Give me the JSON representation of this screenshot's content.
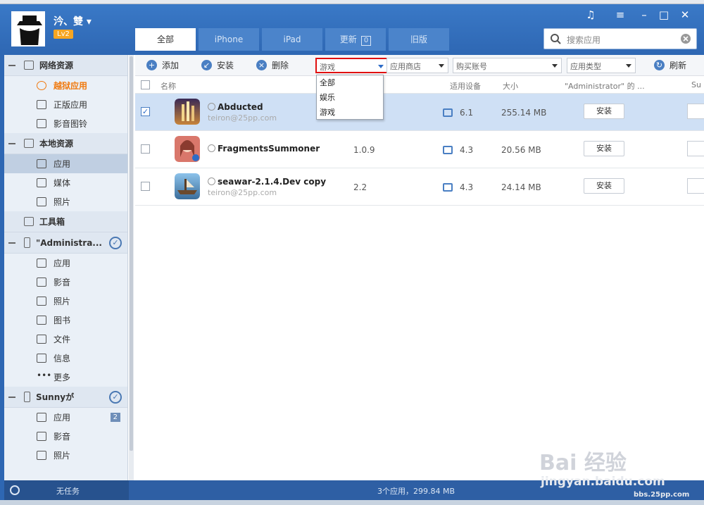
{
  "user": {
    "name": "汵、雙 ▾",
    "level": "Lv2"
  },
  "tabs": [
    {
      "label": "全部",
      "active": true
    },
    {
      "label": "iPhone"
    },
    {
      "label": "iPad"
    },
    {
      "label": "更新",
      "count": "0"
    },
    {
      "label": "旧版"
    }
  ],
  "search": {
    "placeholder": "搜索应用"
  },
  "sidebar": {
    "groups": [
      {
        "label": "网络资源",
        "items": [
          {
            "label": "越狱应用",
            "highlight": true
          },
          {
            "label": "正版应用"
          },
          {
            "label": "影音图铃"
          }
        ]
      },
      {
        "label": "本地资源",
        "items": [
          {
            "label": "应用",
            "selected": true
          },
          {
            "label": "媒体"
          },
          {
            "label": "照片"
          }
        ]
      },
      {
        "label": "工具箱",
        "items": []
      },
      {
        "label": "\"Administra...",
        "items": [
          {
            "label": "应用"
          },
          {
            "label": "影音"
          },
          {
            "label": "照片"
          },
          {
            "label": "图书"
          },
          {
            "label": "文件"
          },
          {
            "label": "信息"
          },
          {
            "label": "更多"
          }
        ]
      },
      {
        "label": "Sunnyが",
        "items": [
          {
            "label": "应用",
            "badge": "2"
          },
          {
            "label": "影音"
          },
          {
            "label": "照片"
          }
        ]
      }
    ]
  },
  "toolbar": {
    "add": "添加",
    "install": "安装",
    "delete": "删除",
    "refresh": "刷新",
    "category_value": "游戏",
    "store_value": "应用商店",
    "account_value": "购买账号",
    "type_value": "应用类型"
  },
  "category_options": [
    "全部",
    "娱乐",
    "游戏"
  ],
  "columns": {
    "name": "名称",
    "device": "适用设备",
    "size": "大小",
    "admin": "\"Administrator\" 的 ...",
    "sunny": "Su"
  },
  "apps": [
    {
      "name": "Abducted",
      "source": "teiron@25pp.com",
      "version": "",
      "device": "6.1",
      "size": "255.14 MB",
      "action": "安装",
      "checked": true
    },
    {
      "name": "FragmentsSummoner",
      "source": "",
      "version": "1.0.9",
      "device": "4.3",
      "size": "20.56 MB",
      "action": "安装",
      "checked": false
    },
    {
      "name": "seawar-2.1.4.Dev copy",
      "source": "teiron@25pp.com",
      "version": "2.2",
      "device": "4.3",
      "size": "24.14 MB",
      "action": "安装",
      "checked": false
    }
  ],
  "status": {
    "tasks": "无任务",
    "summary": "3个应用，299.84 MB"
  },
  "watermark": {
    "brand": "Bai 经验",
    "site": "jingyan.baidu.com",
    "pp": "bbs.25pp.com"
  },
  "colors": {
    "accent": "#2e67b3",
    "selected_row": "#cfe0f5",
    "highlight_item": "#f07a10",
    "dropdown_border": "#e01010"
  }
}
